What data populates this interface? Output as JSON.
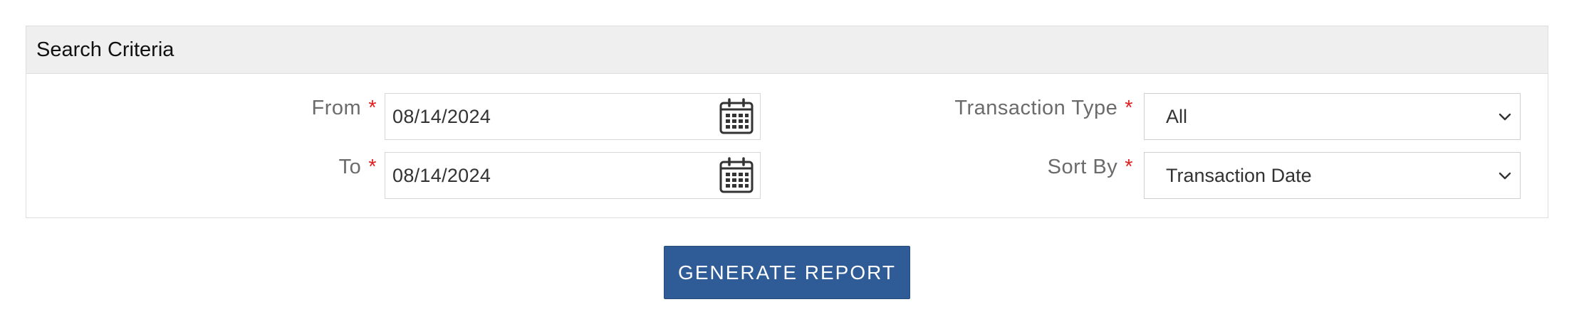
{
  "panel": {
    "title": "Search Criteria"
  },
  "fields": {
    "from": {
      "label": "From",
      "required_mark": "*",
      "value": "08/14/2024",
      "icon": "calendar-icon"
    },
    "to": {
      "label": "To",
      "required_mark": "*",
      "value": "08/14/2024",
      "icon": "calendar-icon"
    },
    "transaction_type": {
      "label": "Transaction Type",
      "required_mark": "*",
      "selected": "All",
      "icon": "chevron-down-icon"
    },
    "sort_by": {
      "label": "Sort By",
      "required_mark": "*",
      "selected": "Transaction Date",
      "icon": "chevron-down-icon"
    }
  },
  "actions": {
    "generate_label": "GENERATE REPORT"
  },
  "colors": {
    "header_bg": "#efefef",
    "required": "#e02020",
    "button_bg": "#2f5c97",
    "label": "#6b6b6b"
  }
}
